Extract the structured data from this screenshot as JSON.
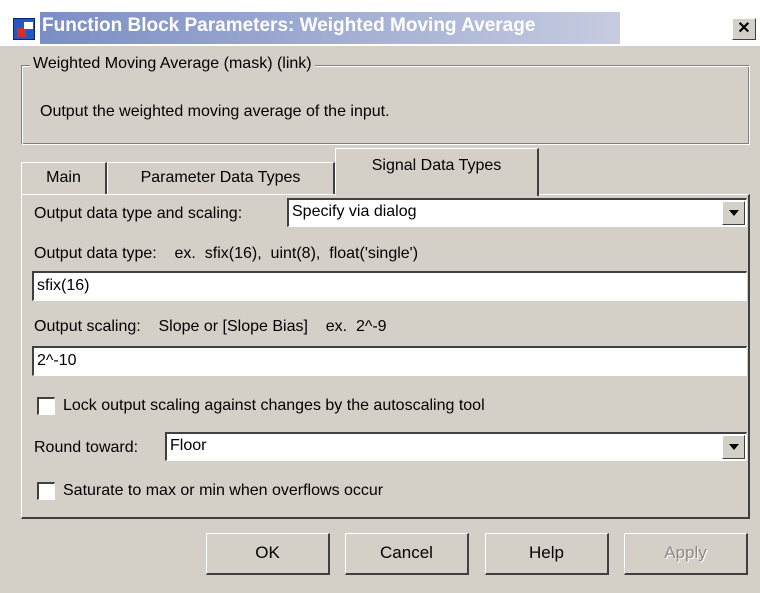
{
  "window": {
    "title": "Function Block Parameters: Weighted Moving Average",
    "close_glyph": "✕"
  },
  "description_group": {
    "legend": "Weighted Moving Average (mask) (link)",
    "text": "Output the weighted moving average of the input."
  },
  "tabs": [
    {
      "label": "Main",
      "active": false
    },
    {
      "label": "Parameter Data Types",
      "active": false
    },
    {
      "label": "Signal Data Types",
      "active": true
    }
  ],
  "signal_data_types": {
    "output_data_type_scaling": {
      "label": "Output data type and scaling:",
      "value": "Specify via dialog"
    },
    "output_data_type": {
      "label": "Output data type:    ex.  sfix(16),  uint(8),  float('single')",
      "value": "sfix(16)"
    },
    "output_scaling": {
      "label": "Output scaling:    Slope or [Slope Bias]    ex.  2^-9",
      "value": "2^-10"
    },
    "lock_scaling": {
      "label": "Lock output scaling against changes by the autoscaling tool",
      "checked": false
    },
    "round_toward": {
      "label": "Round toward:",
      "value": "Floor"
    },
    "saturate": {
      "label": "Saturate to max or min when overflows occur",
      "checked": false
    }
  },
  "buttons": {
    "ok": "OK",
    "cancel": "Cancel",
    "help": "Help",
    "apply": "Apply"
  },
  "colors": {
    "dialog_face": "#d4d0c8",
    "title_bar_start": "#7b8ec4",
    "title_bar_end": "#c6cbe0",
    "disabled_text": "#8c8a84"
  },
  "icons": {
    "window_icon": "simulink-block-icon",
    "close": "close-icon",
    "dropdown": "chevron-down-icon"
  }
}
